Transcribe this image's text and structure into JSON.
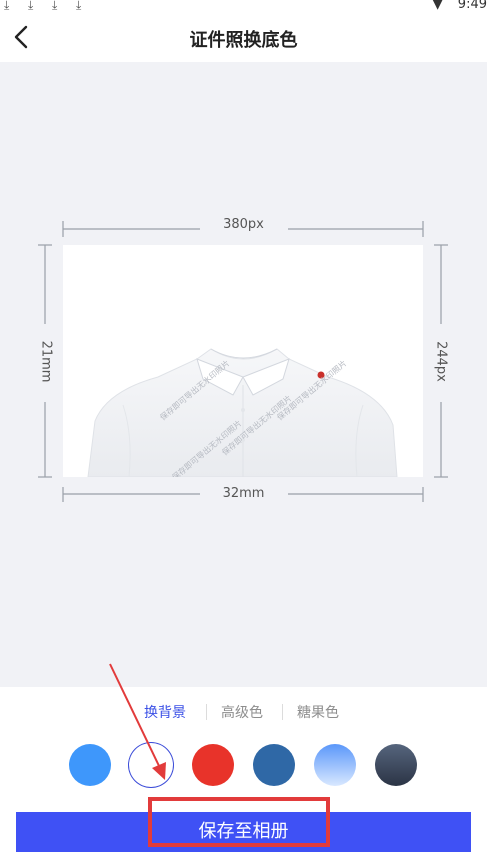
{
  "status_bar": {
    "download_icons": [
      "download-icon",
      "download-icon",
      "download-icon",
      "download-icon"
    ],
    "time": "9:49"
  },
  "header": {
    "title": "证件照换底色"
  },
  "preview": {
    "width_label": "380px",
    "height_label": "244px",
    "physical_height_label": "21mm",
    "physical_width_label": "32mm",
    "watermark_text": "保存即可导出无水印照片"
  },
  "tabs": [
    {
      "label": "换背景",
      "active": true
    },
    {
      "label": "高级色",
      "active": false
    },
    {
      "label": "糖果色",
      "active": false
    }
  ],
  "colors": [
    {
      "name": "blue",
      "color": "#3e97fb",
      "selected": false
    },
    {
      "name": "white",
      "color": "#ffffff",
      "selected": true
    },
    {
      "name": "red",
      "color": "#e8332a",
      "selected": false
    },
    {
      "name": "dark-blue",
      "color": "#2f68a6",
      "selected": false
    },
    {
      "name": "blue-gradient",
      "color": "#6fa8ff",
      "selected": false
    },
    {
      "name": "gray-gradient",
      "color": "#3a4558",
      "selected": false
    }
  ],
  "actions": {
    "save_label": "保存至相册"
  },
  "accent_color": "#3f51f5",
  "annotation_color": "#e23b3b"
}
